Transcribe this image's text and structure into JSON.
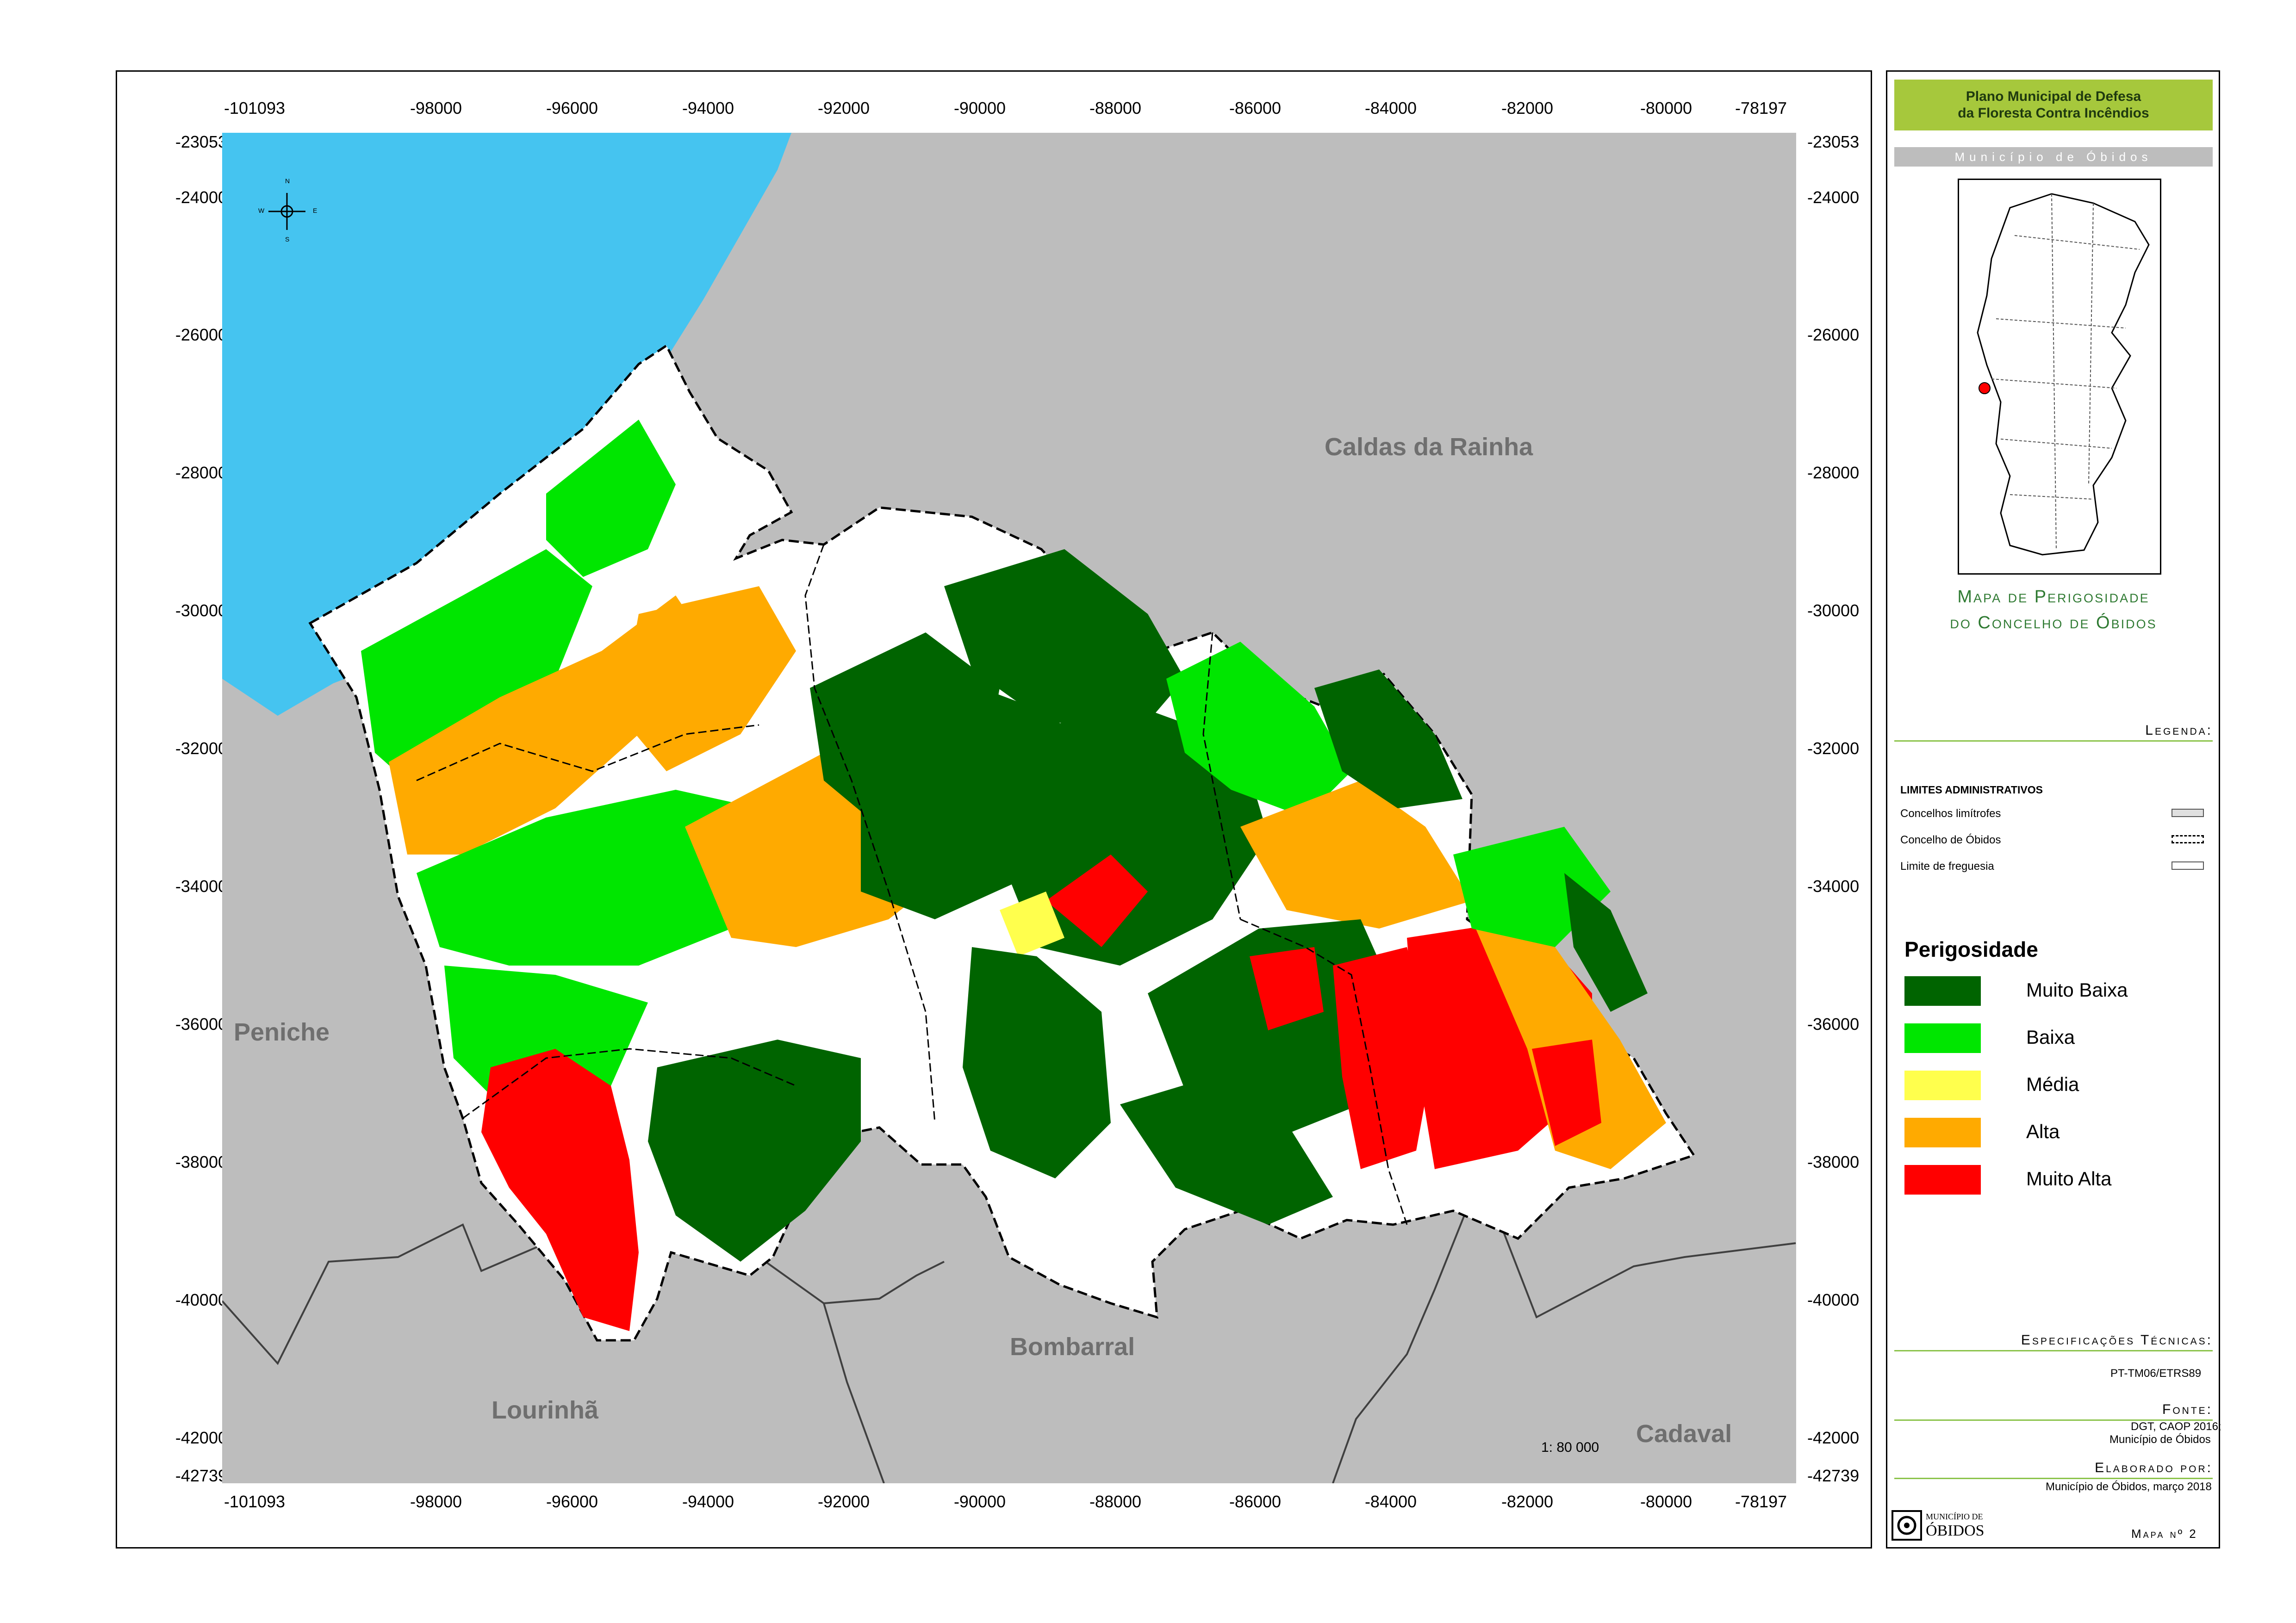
{
  "axis": {
    "x_labels": [
      "-101093",
      "-98000",
      "-96000",
      "-94000",
      "-92000",
      "-90000",
      "-88000",
      "-86000",
      "-84000",
      "-82000",
      "-80000",
      "-78197"
    ],
    "y_labels": [
      "-23053",
      "-24000",
      "-26000",
      "-28000",
      "-30000",
      "-32000",
      "-34000",
      "-36000",
      "-38000",
      "-40000",
      "-42000",
      "-42739"
    ]
  },
  "places": {
    "caldas": "Caldas da Rainha",
    "peniche": "Peniche",
    "lourinha": "Lourinhã",
    "bombarral": "Bombarral",
    "cadaval": "Cadaval"
  },
  "scale_text": "1: 80 000",
  "compass": {
    "n": "N",
    "s": "S",
    "e": "E",
    "w": "W"
  },
  "panel": {
    "title": "Plano Municipal de Defesa\nda Floresta Contra Incêndios",
    "municipality": "Município de Óbidos",
    "map_title_1": "Mapa de Perigosidade",
    "map_title_2": "do Concelho de Óbidos",
    "legend_head": "Legenda:",
    "limits_title": "LIMITES ADMINISTRATIVOS",
    "limits": [
      "Concelhos limítrofes",
      "Concelho de Óbidos",
      "Limite de freguesia"
    ],
    "perig_title": "Perigosidade",
    "classes": [
      {
        "label": "Muito Baixa",
        "color": "#006400"
      },
      {
        "label": "Baixa",
        "color": "#00e600"
      },
      {
        "label": "Média",
        "color": "#ffff4d"
      },
      {
        "label": "Alta",
        "color": "#ffaa00"
      },
      {
        "label": "Muito Alta",
        "color": "#ff0000"
      }
    ],
    "specs_head": "Especificações Técnicas:",
    "specs": "PT-TM06/ETRS89",
    "source_head": "Fonte:",
    "source_1": "DGT, CAOP 2016;",
    "source_2": "Município de Óbidos",
    "made_head": "Elaborado por:",
    "made": "Município de Óbidos, março 2018",
    "logo_top": "MUNICÍPIO DE",
    "logo_bottom": "ÓBIDOS",
    "map_no": "Mapa nº 2"
  },
  "colors": {
    "sea": "#45c4f0",
    "neighbor": "#bdbdbd",
    "unclassified": "#ffffff"
  }
}
